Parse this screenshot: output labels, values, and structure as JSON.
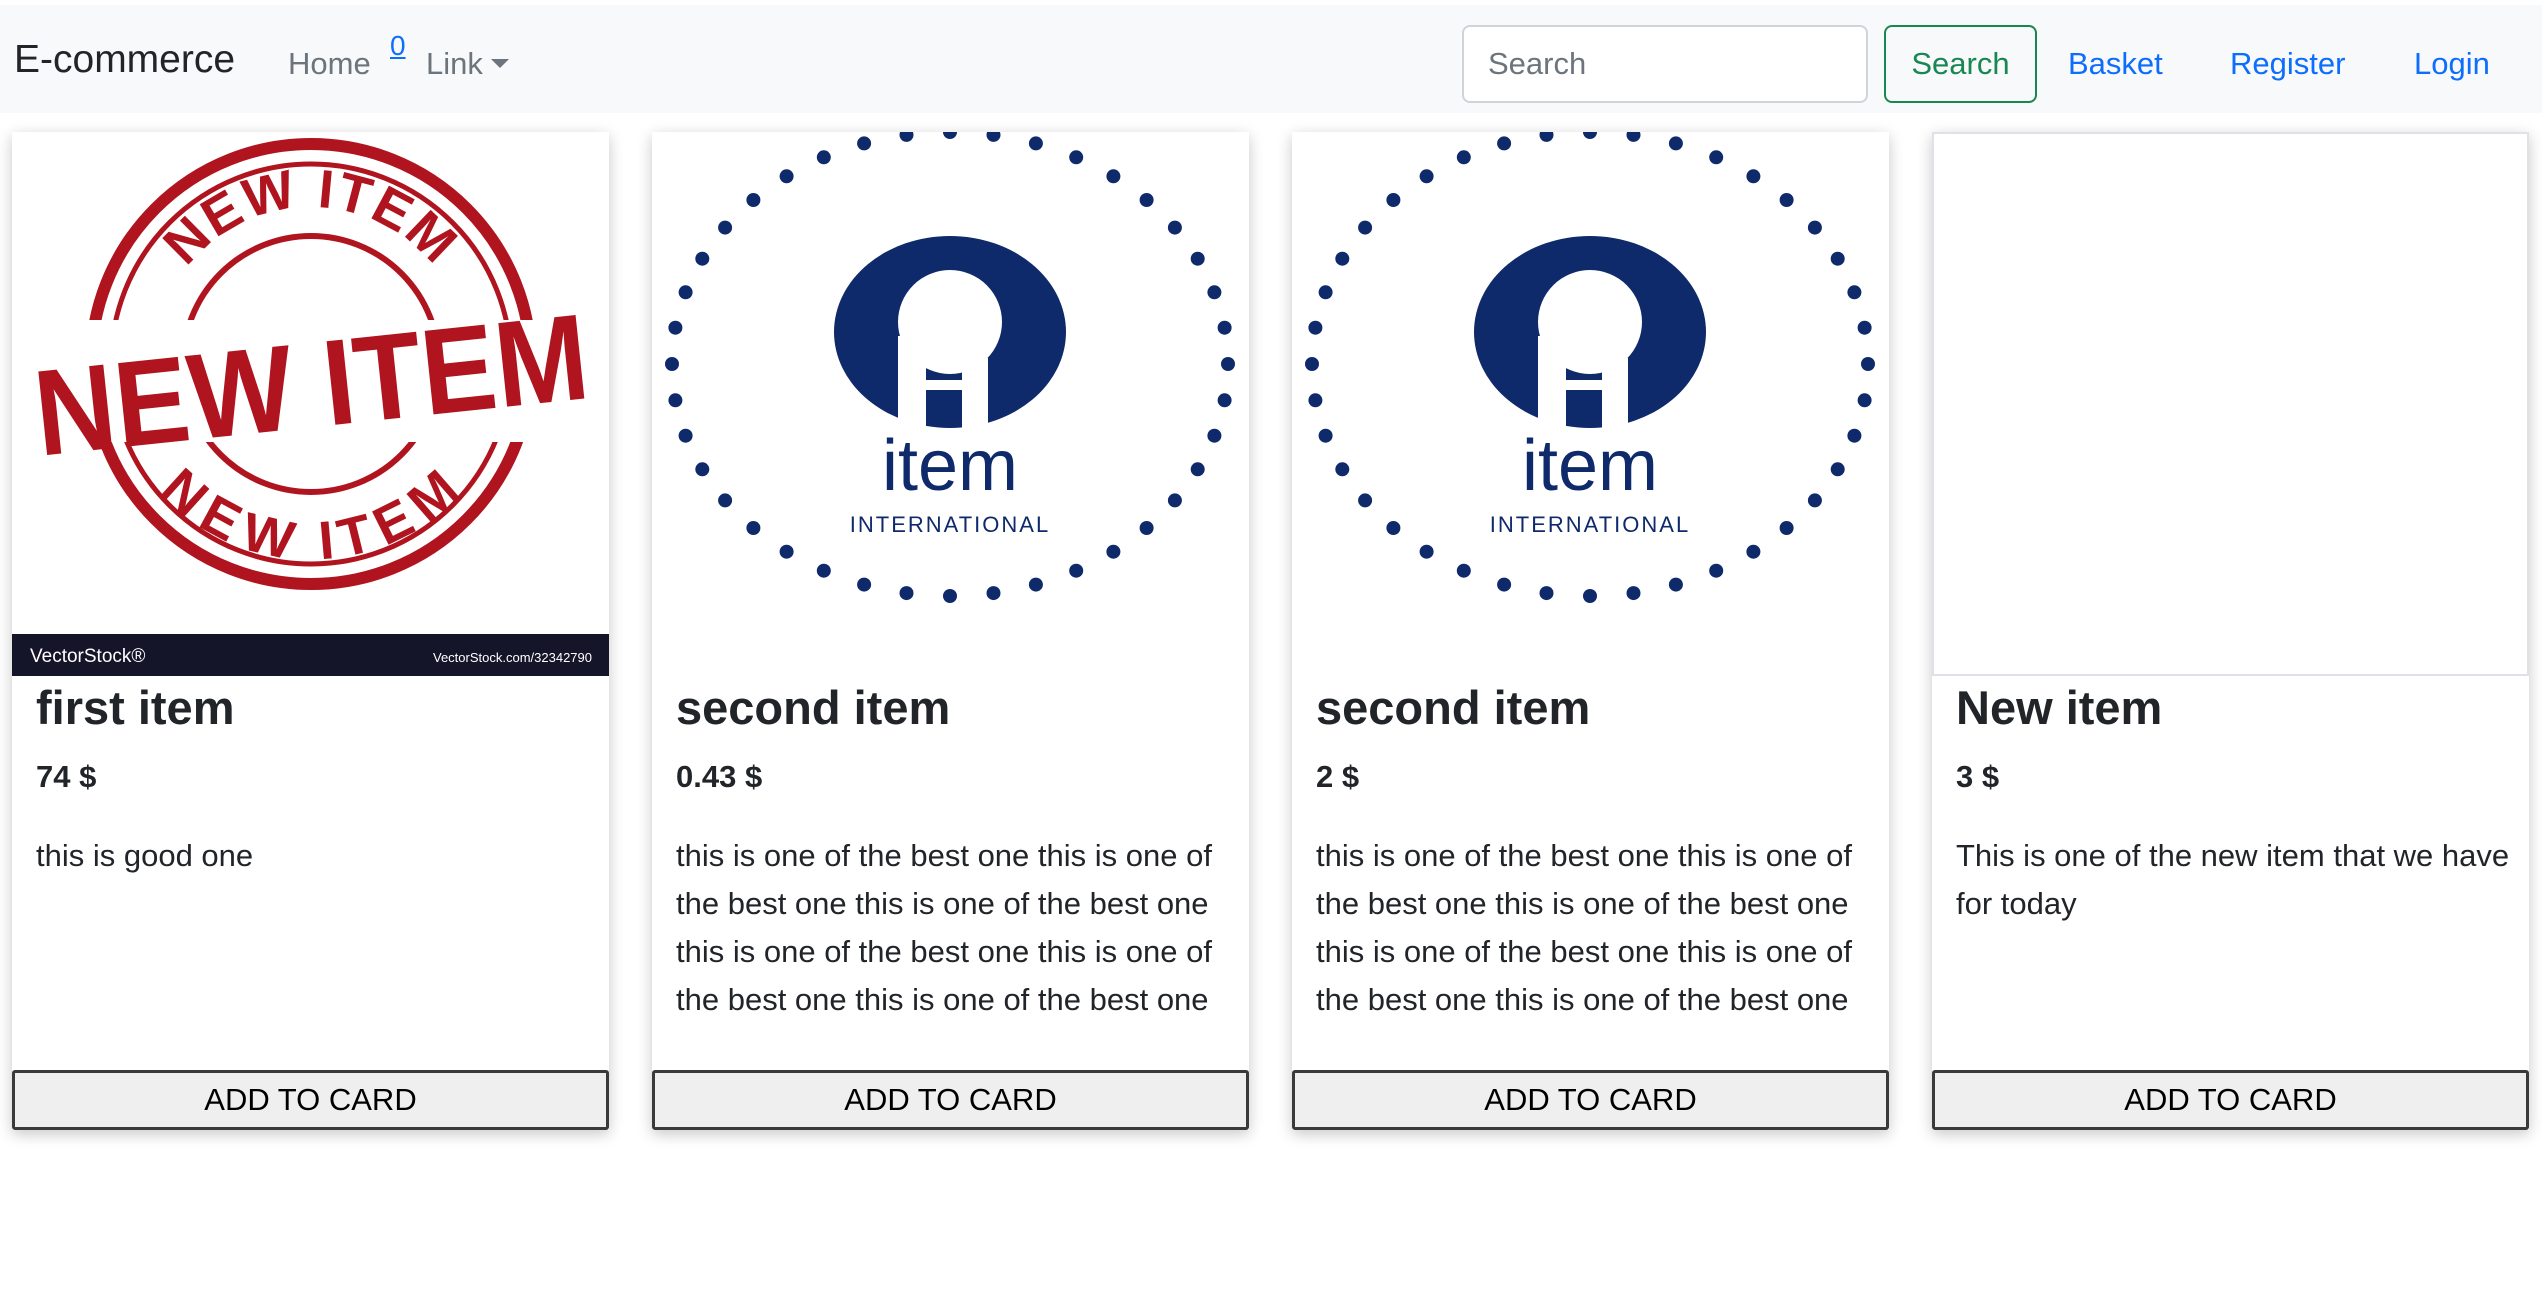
{
  "navbar": {
    "brand": "E-commerce",
    "home": "Home",
    "count": "0",
    "link": "Link",
    "search_placeholder": "Search",
    "search_button": "Search",
    "basket": "Basket",
    "register": "Register",
    "login": "Login"
  },
  "products": [
    {
      "image": {
        "badge_top": "NEW ITEM",
        "badge_center": "NEW ITEM",
        "badge_bottom": "NEW ITEM",
        "footer_brand": "VectorStock®",
        "footer_url": "VectorStock.com/32342790"
      },
      "title": "first item",
      "price": "74 $",
      "description": "this is good one",
      "button": "ADD TO CARD"
    },
    {
      "image": {
        "logo_word": "item",
        "logo_sub": "INTERNATIONAL"
      },
      "title": "second item",
      "price": "0.43 $",
      "description": "this is one of the best one this is one of the best one this is one of the best one this is one of the best one this is one of the best one this is one of the best one",
      "button": "ADD TO CARD"
    },
    {
      "image": {
        "logo_word": "item",
        "logo_sub": "INTERNATIONAL"
      },
      "title": "second item",
      "price": "2 $",
      "description": "this is one of the best one this is one of the best one this is one of the best one this is one of the best one this is one of the best one this is one of the best one",
      "button": "ADD TO CARD"
    },
    {
      "title": "New item",
      "price": "3 $",
      "description": "This is one of the new item that we have for today",
      "button": "ADD TO CARD"
    }
  ],
  "colors": {
    "navbar_bg": "#f8f9fa",
    "link_blue": "#0d6efd",
    "search_green": "#198754",
    "stamp_red": "#b0141f",
    "logo_navy": "#0f2a6b"
  }
}
